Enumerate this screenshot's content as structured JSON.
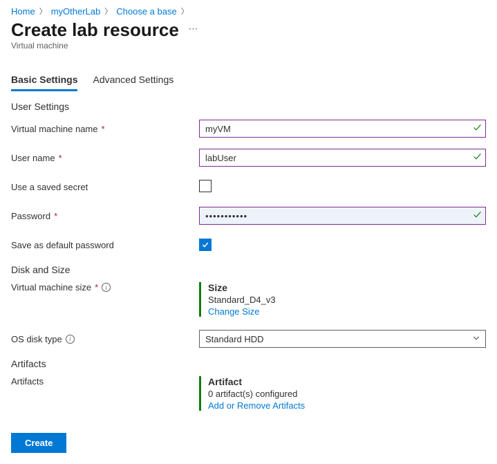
{
  "breadcrumb": {
    "home": "Home",
    "lab": "myOtherLab",
    "choose": "Choose a base"
  },
  "header": {
    "title": "Create lab resource",
    "subtitle": "Virtual machine"
  },
  "tabs": {
    "basic": "Basic Settings",
    "advanced": "Advanced Settings"
  },
  "sections": {
    "user": "User Settings",
    "disk": "Disk and Size",
    "artifacts_section": "Artifacts"
  },
  "labels": {
    "vm_name": "Virtual machine name",
    "user_name": "User name",
    "saved_secret": "Use a saved secret",
    "password": "Password",
    "save_default": "Save as default password",
    "vm_size": "Virtual machine size",
    "os_disk": "OS disk type",
    "artifacts": "Artifacts"
  },
  "values": {
    "vm_name": "myVM",
    "user_name": "labUser",
    "password": "•••••••••••",
    "os_disk": "Standard HDD"
  },
  "size_block": {
    "title": "Size",
    "value": "Standard_D4_v3",
    "link": "Change Size"
  },
  "artifact_block": {
    "title": "Artifact",
    "value": "0 artifact(s) configured",
    "link": "Add or Remove Artifacts"
  },
  "buttons": {
    "create": "Create"
  }
}
